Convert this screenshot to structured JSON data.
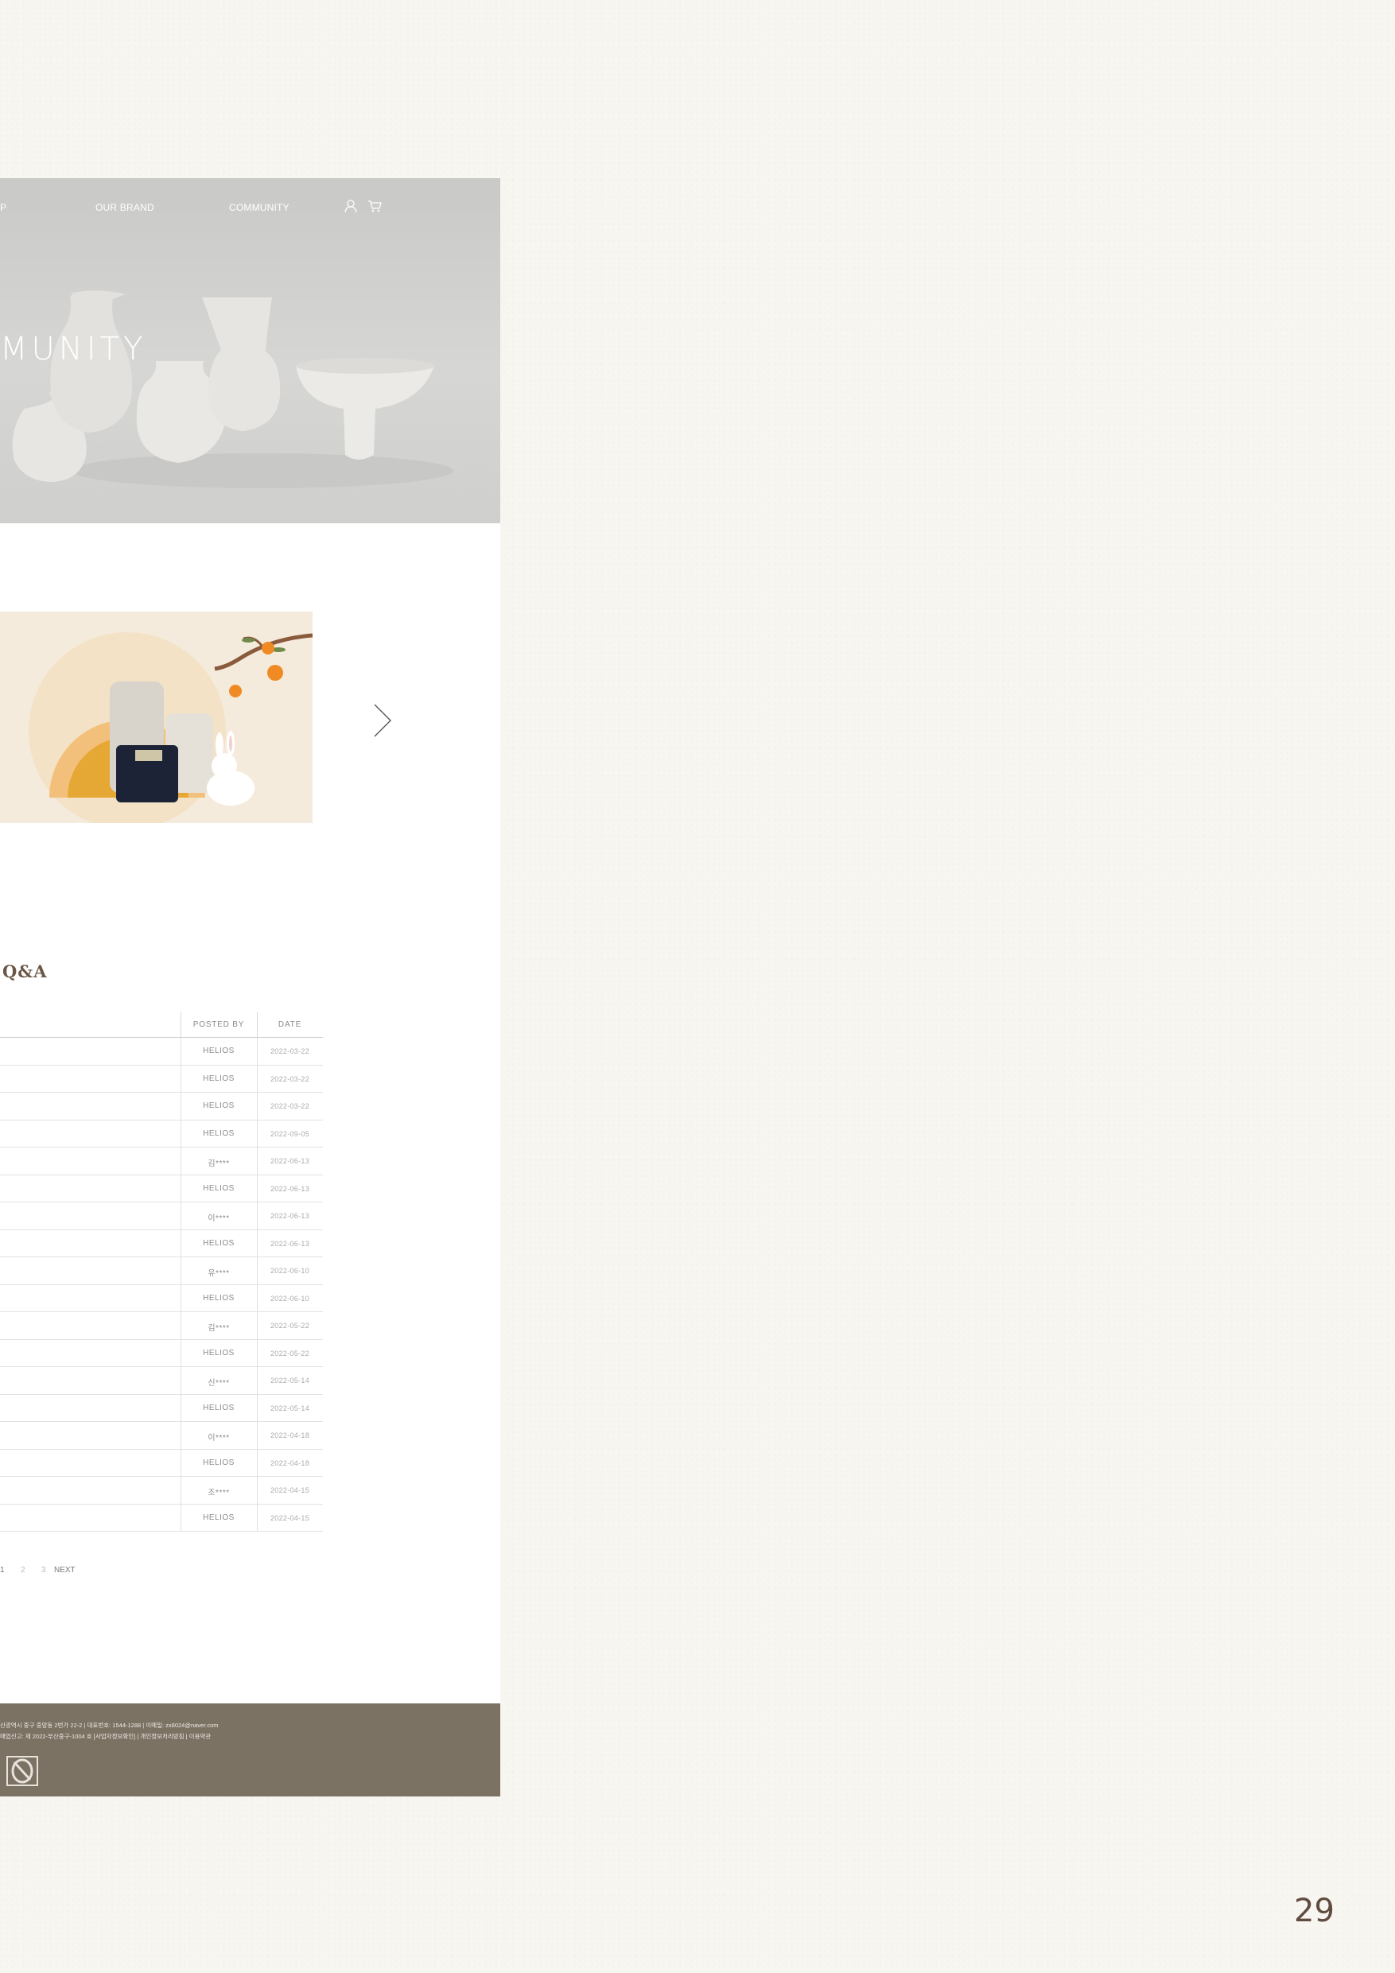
{
  "nav": {
    "partial_item": "P",
    "brand": "OUR BRAND",
    "community": "COMMUNITY",
    "user_icon": "user-icon",
    "cart_icon": "cart-icon"
  },
  "hero": {
    "title": "MUNITY"
  },
  "banner": {
    "next_icon": "chevron-right-icon"
  },
  "board": {
    "title": "Q&A",
    "columns": {
      "posted_by": "POSTED BY",
      "date": "DATE"
    },
    "rows": [
      {
        "author": "HELIOS",
        "date": "2022-03-22"
      },
      {
        "author": "HELIOS",
        "date": "2022-03-22"
      },
      {
        "author": "HELIOS",
        "date": "2022-03-22"
      },
      {
        "author": "HELIOS",
        "date": "2022-09-05"
      },
      {
        "author": "김****",
        "date": "2022-06-13"
      },
      {
        "author": "HELIOS",
        "date": "2022-06-13"
      },
      {
        "author": "이****",
        "date": "2022-06-13"
      },
      {
        "author": "HELIOS",
        "date": "2022-06-13"
      },
      {
        "author": "유****",
        "date": "2022-06-10"
      },
      {
        "author": "HELIOS",
        "date": "2022-06-10"
      },
      {
        "author": "김****",
        "date": "2022-05-22"
      },
      {
        "author": "HELIOS",
        "date": "2022-05-22"
      },
      {
        "author": "신****",
        "date": "2022-05-14"
      },
      {
        "author": "HELIOS",
        "date": "2022-05-14"
      },
      {
        "author": "이****",
        "date": "2022-04-18"
      },
      {
        "author": "HELIOS",
        "date": "2022-04-18"
      },
      {
        "author": "조****",
        "date": "2022-04-15"
      },
      {
        "author": "HELIOS",
        "date": "2022-04-15"
      }
    ]
  },
  "pagination": {
    "page1": "1",
    "page2": "2",
    "page3": "3",
    "next": "NEXT"
  },
  "footer": {
    "line1": "산광역시 중구 중앙동 2번가 22-2 | 대표번호: 1544-1288 | 이메일: zx8024@naver.com",
    "line2": "매업신고: 제 2022-부산중구-1004 호 [사업자정보확인] | 개인정보처리방침 | 이용약관",
    "logo": "brand-logo"
  },
  "page_number": "29"
}
